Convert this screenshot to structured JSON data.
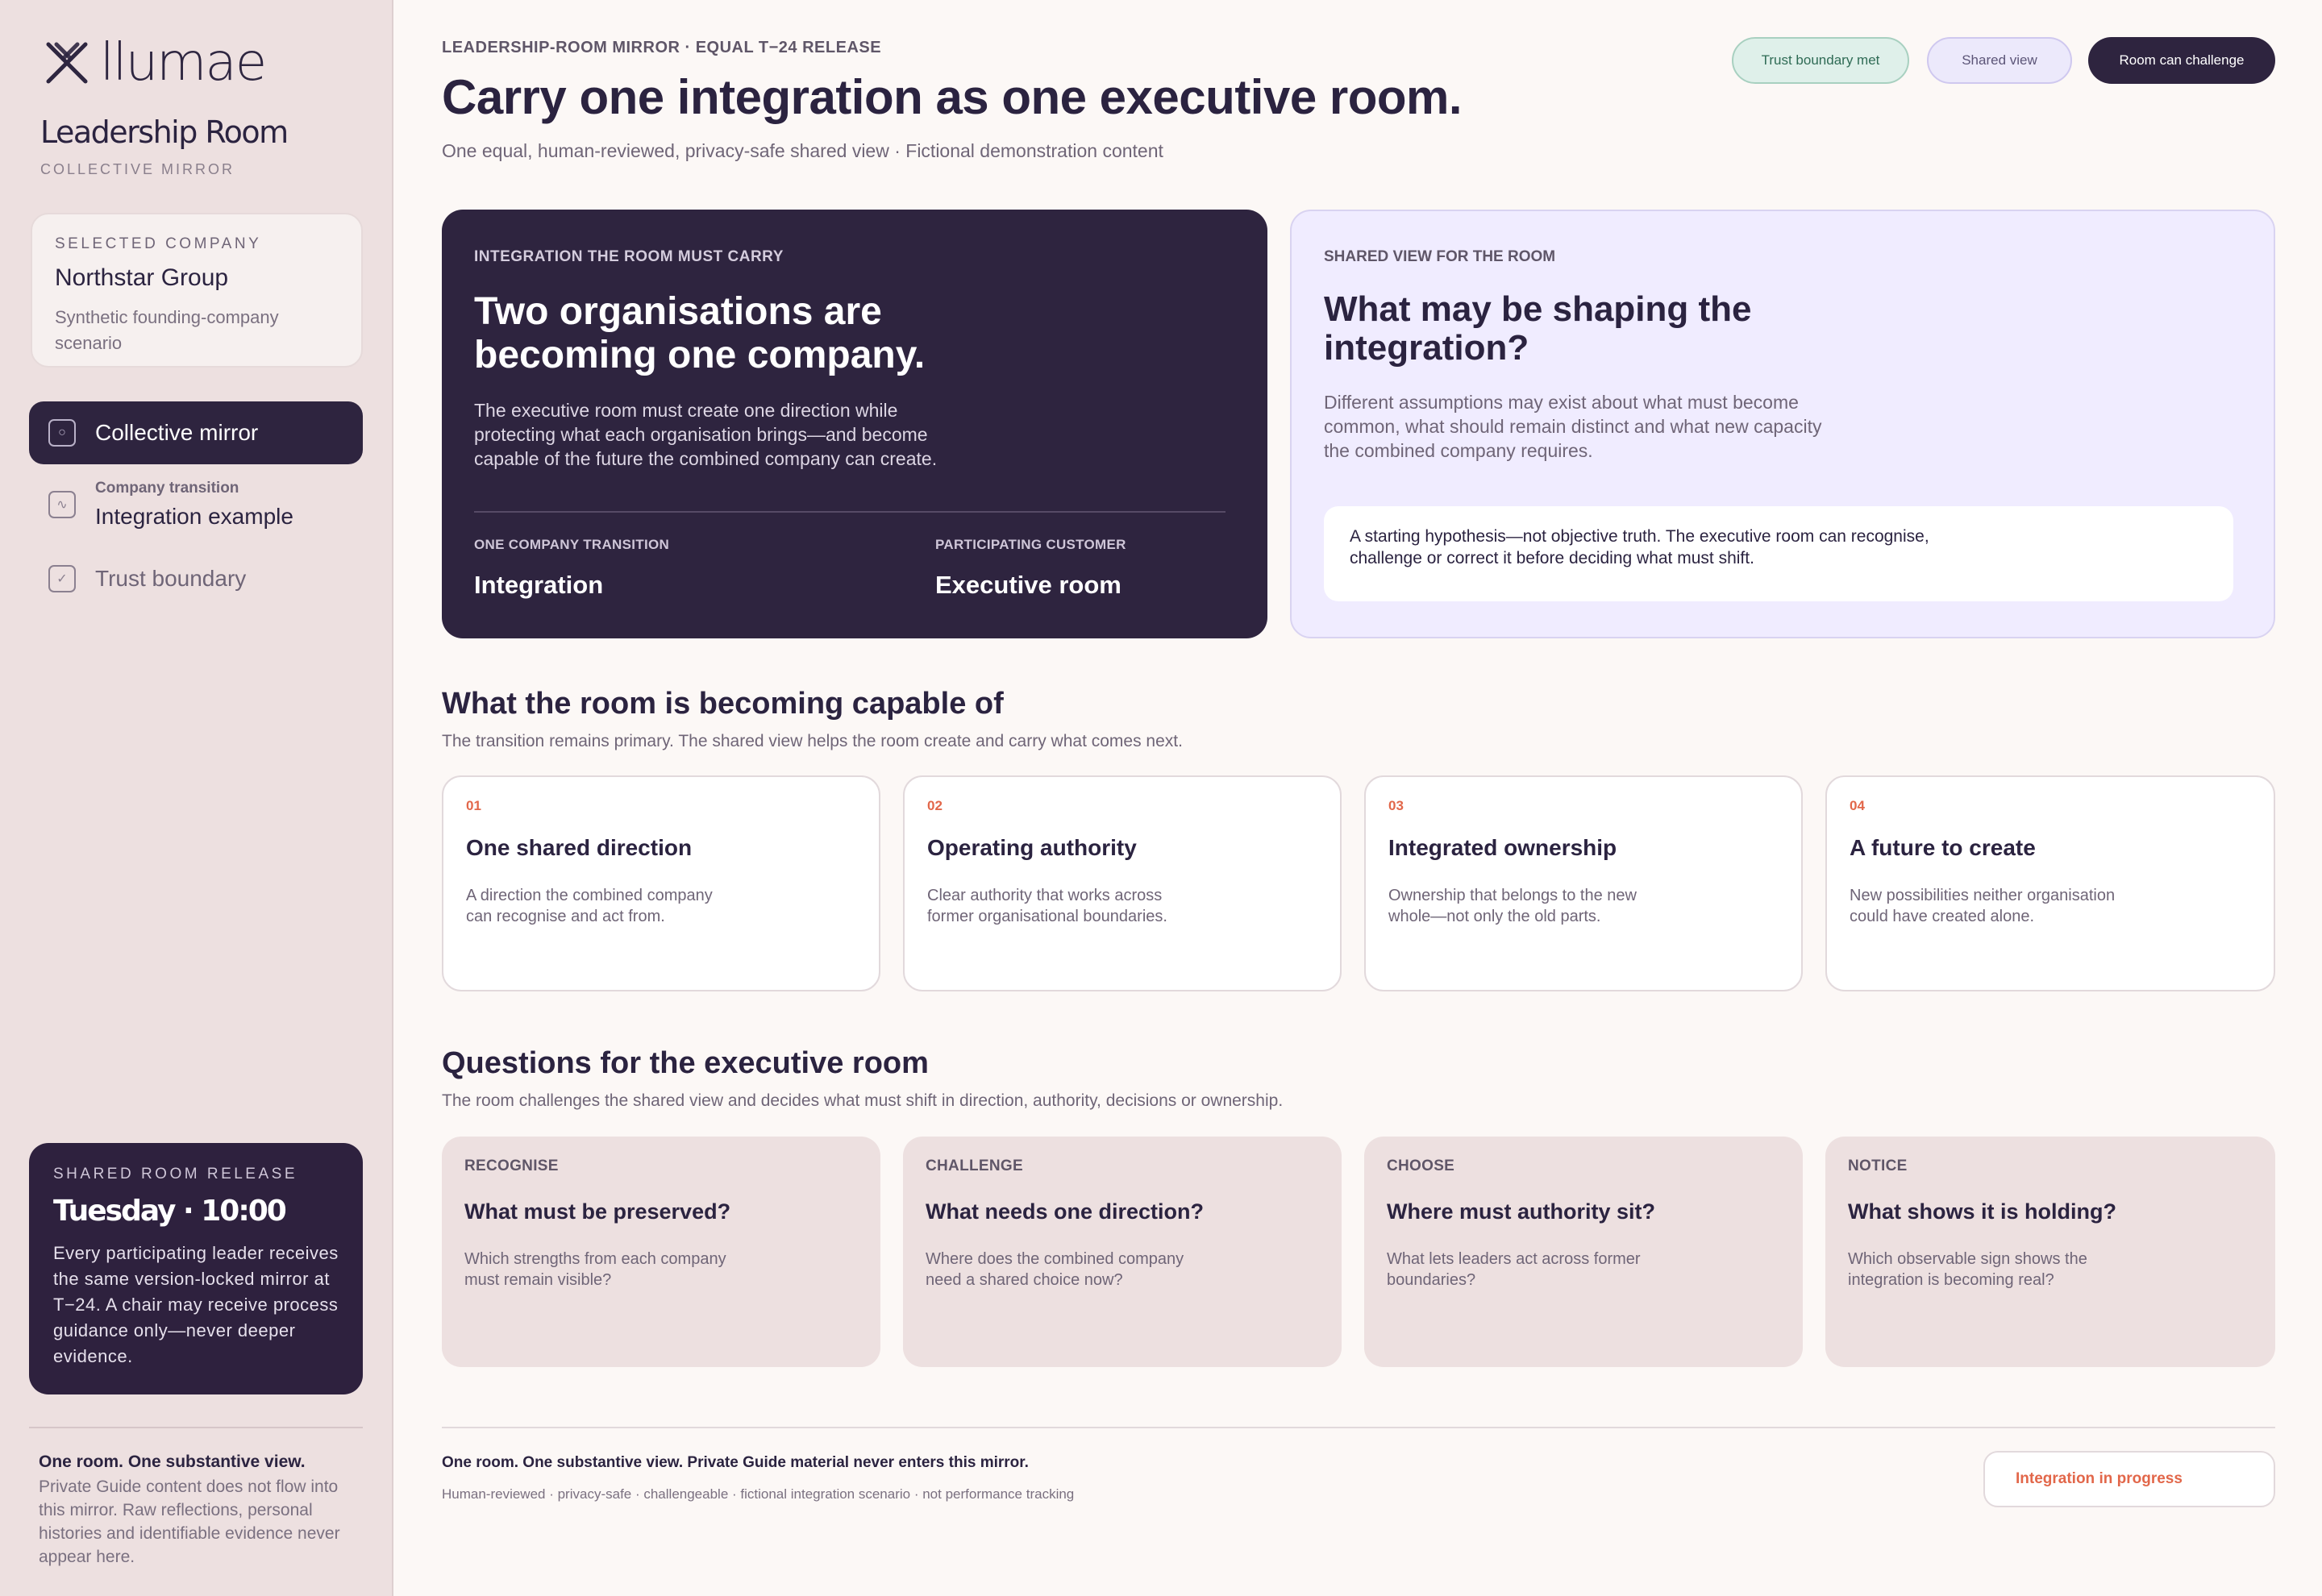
{
  "brand": {
    "logo_word": "llumae"
  },
  "sidebar": {
    "room_title": "Leadership Room",
    "room_subtitle": "COLLECTIVE MIRROR",
    "company": {
      "kicker": "SELECTED COMPANY",
      "name": "Northstar Group",
      "description": "Synthetic founding-company scenario"
    },
    "nav": [
      {
        "label": "Collective mirror",
        "icon": "circle-icon",
        "active": true
      },
      {
        "small": "Company transition",
        "label": "Integration example",
        "icon": "wave-icon",
        "active": false
      },
      {
        "label": "Trust boundary",
        "icon": "check-icon",
        "active": false
      }
    ],
    "release": {
      "kicker": "SHARED ROOM RELEASE",
      "when": "Tuesday · 10:00",
      "body": "Every participating leader receives the same version-locked mirror at T−24. A chair may receive process guidance only—never deeper evidence."
    },
    "footer": {
      "title": "One room. One substantive view.",
      "body": "Private Guide content does not flow into this mirror. Raw reflections, personal histories and identifiable evidence never appear here."
    }
  },
  "header": {
    "eyebrow": "LEADERSHIP-ROOM MIRROR · EQUAL T−24 RELEASE",
    "title": "Carry one integration as one executive room.",
    "subtitle": "One equal, human-reviewed, privacy-safe shared view · Fictional demonstration content",
    "pills": {
      "trust": "Trust boundary met",
      "shared": "Shared view",
      "challenge": "Room can challenge"
    }
  },
  "hero_dark": {
    "kicker": "INTEGRATION THE ROOM MUST CARRY",
    "title": "Two organisations are becoming one company.",
    "body": "The executive room must create one direction while protecting what each organisation brings—and become capable of the future the combined company can create.",
    "left_label": "ONE COMPANY TRANSITION",
    "left_value": "Integration",
    "right_label": "PARTICIPATING CUSTOMER",
    "right_value": "Executive room"
  },
  "hero_light": {
    "kicker": "SHARED VIEW FOR THE ROOM",
    "title": "What may be shaping the integration?",
    "body": "Different assumptions may exist about what must become common, what should remain distinct and what new capacity the combined company requires.",
    "note": "A starting hypothesis—not objective truth. The executive room can recognise, challenge or correct it before deciding what must shift."
  },
  "capabilities": {
    "title": "What the room is becoming capable of",
    "subtitle": "The transition remains primary. The shared view helps the room create and carry what comes next.",
    "cards": [
      {
        "num": "01",
        "title": "One shared direction",
        "desc": "A direction the combined company can recognise and act from."
      },
      {
        "num": "02",
        "title": "Operating authority",
        "desc": "Clear authority that works across former organisational boundaries."
      },
      {
        "num": "03",
        "title": "Integrated ownership",
        "desc": "Ownership that belongs to the new whole—not only the old parts."
      },
      {
        "num": "04",
        "title": "A future to create",
        "desc": "New possibilities neither organisation could have created alone."
      }
    ]
  },
  "questions": {
    "title": "Questions for the executive room",
    "subtitle": "The room challenges the shared view and decides what must shift in direction, authority, decisions or ownership.",
    "cards": [
      {
        "kicker": "RECOGNISE",
        "title": "What must be preserved?",
        "desc": "Which strengths from each company must remain visible?"
      },
      {
        "kicker": "CHALLENGE",
        "title": "What needs one direction?",
        "desc": "Where does the combined company need a shared choice now?"
      },
      {
        "kicker": "CHOOSE",
        "title": "Where must authority sit?",
        "desc": "What lets leaders act across former boundaries?"
      },
      {
        "kicker": "NOTICE",
        "title": "What shows it is holding?",
        "desc": "Which observable sign shows the integration is becoming real?"
      }
    ]
  },
  "footer": {
    "title": "One room. One substantive view. Private Guide material never enters this mirror.",
    "tags": "Human-reviewed · privacy-safe · challengeable · fictional integration scenario · not performance tracking",
    "status": "Integration in progress"
  },
  "colors": {
    "accent_dark": "#2e243f",
    "accent_orange": "#e2674a",
    "trust_green": "#2f6b55",
    "lavender": "#f0ecff"
  }
}
